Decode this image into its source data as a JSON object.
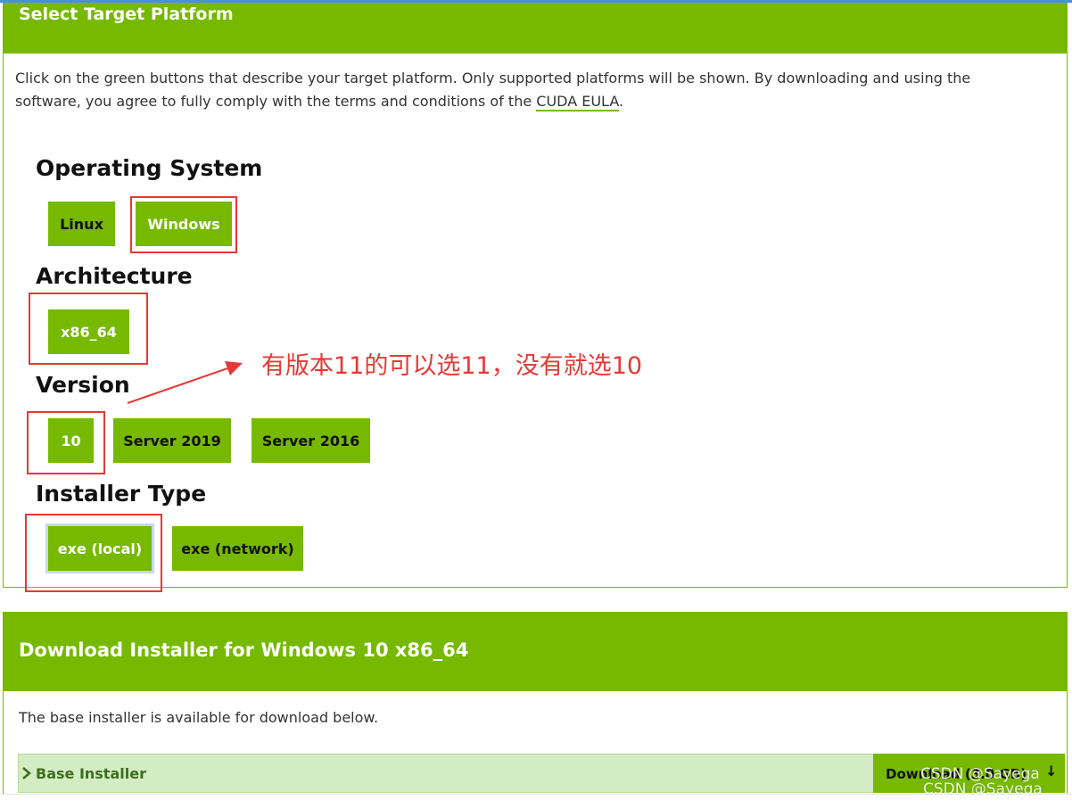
{
  "select_panel": {
    "title": "Select Target Platform",
    "intro": "Click on the green buttons that describe your target platform. Only supported platforms will be shown. By downloading and using the software, you agree to fully comply with the terms and conditions of the ",
    "eula_link": "CUDA EULA",
    "intro_end": "."
  },
  "sections": {
    "os": {
      "title": "Operating System",
      "options": [
        "Linux",
        "Windows"
      ],
      "selected": "Windows"
    },
    "arch": {
      "title": "Architecture",
      "options": [
        "x86_64"
      ],
      "selected": "x86_64"
    },
    "version": {
      "title": "Version",
      "options": [
        "10",
        "Server 2019",
        "Server 2016"
      ],
      "selected": "10"
    },
    "installer": {
      "title": "Installer Type",
      "options": [
        "exe (local)",
        "exe (network)"
      ],
      "selected": "exe (local)"
    }
  },
  "annotation": {
    "text": "有版本11的可以选11，没有就选10",
    "color": "#e53935"
  },
  "download_panel": {
    "title": "Download Installer for Windows 10 x86_64",
    "description": "The base installer is available for download below.",
    "base_installer_label": "Base Installer",
    "download_label": "Download (3.0 GB)"
  },
  "watermark": {
    "line1": "CSDN @Sayega",
    "line2": "CSDN @Sayega"
  },
  "colors": {
    "accent": "#76b900",
    "annotation": "#e53935",
    "base_row_bg": "#d4ecc4"
  }
}
